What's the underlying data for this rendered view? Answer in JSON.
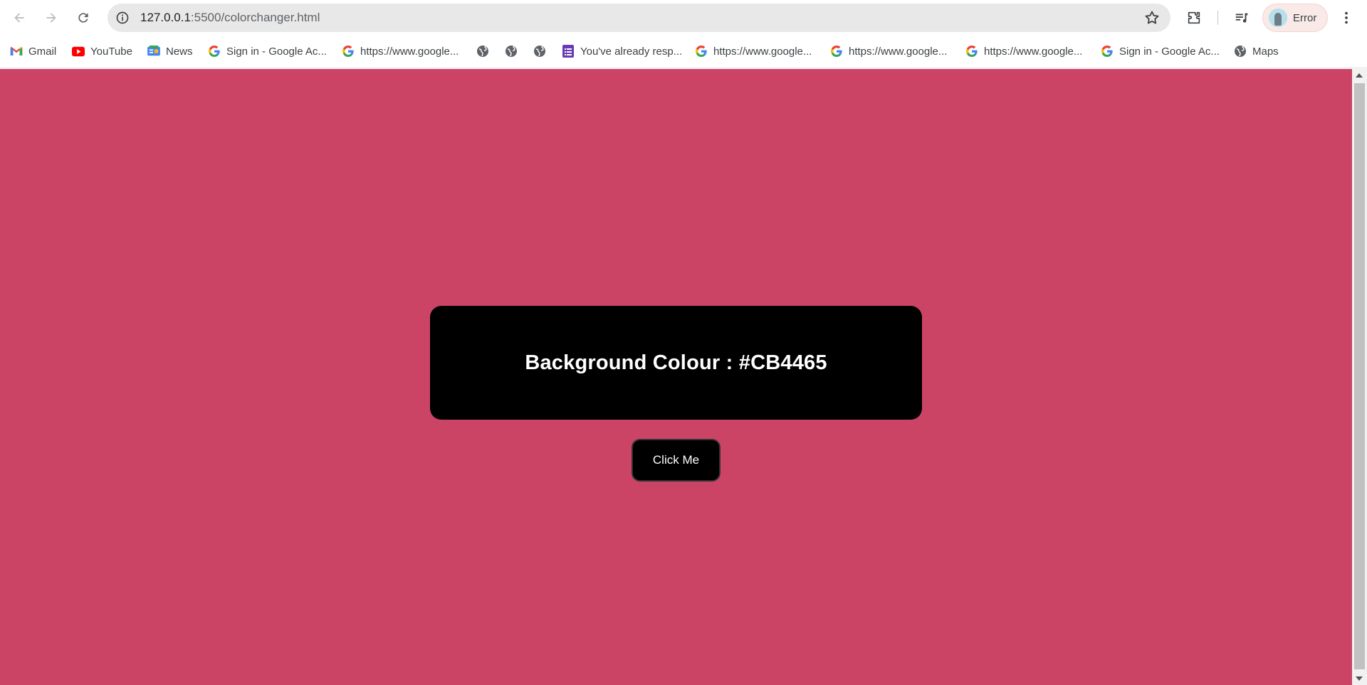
{
  "browser": {
    "url_host": "127.0.0.1",
    "url_path": ":5500/colorchanger.html",
    "profile_label": "Error",
    "icons": {
      "back": "arrow-left-icon",
      "forward": "arrow-right-icon",
      "reload": "reload-icon",
      "site_info": "info-icon",
      "bookmark_star": "star-icon",
      "extensions": "puzzle-icon",
      "media": "media-queue-icon",
      "menu": "kebab-menu-icon"
    }
  },
  "bookmarks": [
    {
      "label": "Gmail",
      "icon": "gmail-icon"
    },
    {
      "label": "YouTube",
      "icon": "youtube-icon"
    },
    {
      "label": "News",
      "icon": "google-news-icon"
    },
    {
      "label": "Sign in - Google Ac...",
      "icon": "google-icon"
    },
    {
      "label": "https://www.google...",
      "icon": "google-icon"
    },
    {
      "label": "",
      "icon": "globe-icon"
    },
    {
      "label": "",
      "icon": "globe-icon"
    },
    {
      "label": "",
      "icon": "globe-icon"
    },
    {
      "label": "You've already resp...",
      "icon": "google-forms-icon"
    },
    {
      "label": "https://www.google...",
      "icon": "google-icon"
    },
    {
      "label": "https://www.google...",
      "icon": "google-icon"
    },
    {
      "label": "https://www.google...",
      "icon": "google-icon"
    },
    {
      "label": "Sign in - Google Ac...",
      "icon": "google-icon"
    },
    {
      "label": "Maps",
      "icon": "globe-icon"
    }
  ],
  "page": {
    "background_color": "#CB4465",
    "heading": "Background Colour : #CB4465",
    "button_label": "Click Me"
  }
}
